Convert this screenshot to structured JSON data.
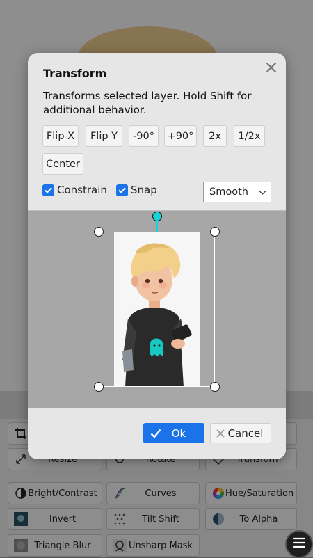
{
  "background": {
    "tools_row1": [
      {
        "label": "",
        "icon": "crop-icon"
      },
      {
        "label": "",
        "icon": ""
      },
      {
        "label": "",
        "icon": ""
      }
    ],
    "tools_row2": [
      {
        "label": "Resize",
        "icon": "resize-icon"
      },
      {
        "label": "Rotate",
        "icon": "rotate-icon"
      },
      {
        "label": "Transform",
        "icon": "transform-icon"
      }
    ],
    "filters": [
      {
        "label": "Bright/Contrast",
        "icon": "brightness-contrast-icon"
      },
      {
        "label": "Curves",
        "icon": "curves-icon"
      },
      {
        "label": "Hue/Saturation",
        "icon": "hue-saturation-icon"
      },
      {
        "label": "Invert",
        "icon": "invert-icon"
      },
      {
        "label": "Tilt Shift",
        "icon": "tilt-shift-icon"
      },
      {
        "label": "To Alpha",
        "icon": "to-alpha-icon"
      },
      {
        "label": "Triangle Blur",
        "icon": "triangle-blur-icon"
      },
      {
        "label": "Unsharp Mask",
        "icon": "unsharp-mask-icon"
      }
    ]
  },
  "dialog": {
    "title": "Transform",
    "description": "Transforms selected layer. Hold Shift for additional behavior.",
    "buttons": {
      "flip_x": "Flip X",
      "flip_y": "Flip Y",
      "rot_minus": "-90°",
      "rot_plus": "+90°",
      "scale_up": "2x",
      "scale_down": "1/2x",
      "center": "Center"
    },
    "constrain": {
      "label": "Constrain",
      "checked": true
    },
    "snap": {
      "label": "Snap",
      "checked": true
    },
    "interpolation": {
      "value": "Smooth"
    },
    "ok_label": "Ok",
    "cancel_label": "Cancel"
  },
  "colors": {
    "accent": "#1a73e8",
    "rotate_handle": "#19d3d8",
    "dialog_bg": "#e6e6e6",
    "preview_bg": "#a7a7a7"
  }
}
